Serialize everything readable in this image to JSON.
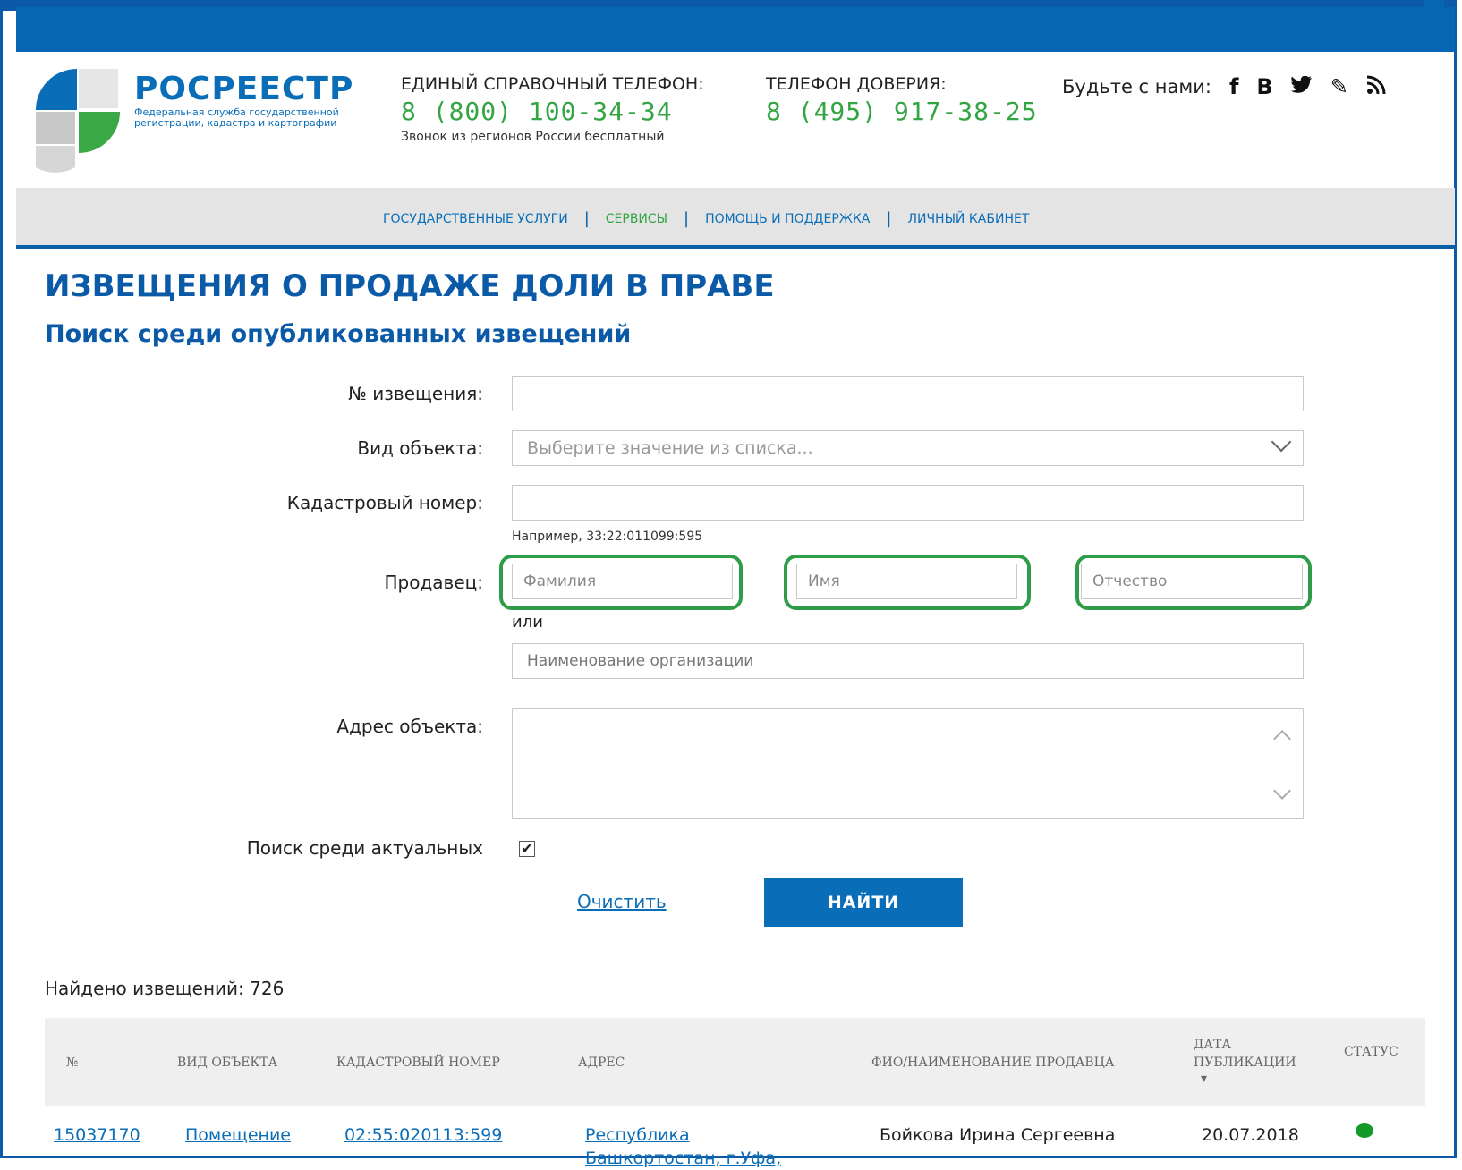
{
  "brand": {
    "name": "РОСРЕЕСТР",
    "subtitle": "Федеральная служба государственной регистрации, кадастра и картографии"
  },
  "phones": {
    "main_title": "ЕДИНЫЙ СПРАВОЧНЫЙ ТЕЛЕФОН:",
    "main_number": "8 (800) 100-34-34",
    "main_note": "Звонок из регионов России бесплатный",
    "trust_title": "ТЕЛЕФОН ДОВЕРИЯ:",
    "trust_number": "8 (495) 917-38-25"
  },
  "social": {
    "label": "Будьте с нами:",
    "icons": [
      "facebook-icon",
      "vk-icon",
      "twitter-icon",
      "livejournal-icon",
      "rss-icon"
    ],
    "glyphs": [
      "f",
      "В",
      "🐦",
      "✎",
      "⟩"
    ]
  },
  "nav": {
    "items": [
      "ГОСУДАРСТВЕННЫЕ УСЛУГИ",
      "СЕРВИСЫ",
      "ПОМОЩЬ И ПОДДЕРЖКА",
      "ЛИЧНЫЙ КАБИНЕТ"
    ],
    "separator": "|"
  },
  "page": {
    "title": "ИЗВЕЩЕНИЯ О ПРОДАЖЕ ДОЛИ В ПРАВЕ",
    "subtitle": "Поиск среди опубликованных извещений"
  },
  "form": {
    "notice_label": "№ извещения:",
    "notice_value": "",
    "object_type_label": "Вид объекта:",
    "object_type_placeholder": "Выберите значение из списка...",
    "cadastral_label": "Кадастровый номер:",
    "cadastral_value": "",
    "cadastral_hint": "Например, 33:22:011099:595",
    "seller_label": "Продавец:",
    "last_name_placeholder": "Фамилия",
    "first_name_placeholder": "Имя",
    "patronymic_placeholder": "Отчество",
    "or_text": "или",
    "org_placeholder": "Наименование организации",
    "address_label": "Адрес объекта:",
    "actual_label": "Поиск среди актуальных",
    "actual_checked": "✔",
    "clear_label": "Очистить",
    "find_label": "НАЙТИ"
  },
  "results": {
    "found_text": "Найдено извещений: 726",
    "columns": [
      "№",
      "ВИД ОБЪЕКТА",
      "КАДАСТРОВЫЙ НОМЕР",
      "АДРЕС",
      "ФИО/НАИМЕНОВАНИЕ ПРОДАВЦА",
      "ДАТА ПУБЛИКАЦИИ",
      "СТАТУС"
    ],
    "sort_indicator": "▾",
    "rows": [
      {
        "number": "15037170",
        "object_type": "Помещение",
        "cadastral": "02:55:020113:599",
        "address_line1": "Республика",
        "address_line2": "Башкортостан, г.Уфа,",
        "seller": "Бойкова Ирина Сергеевна",
        "date": "20.07.2018",
        "status_color": "#139a2a"
      }
    ]
  },
  "colors": {
    "brand_blue": "#0666b3",
    "accent_green": "#33a542",
    "highlight_ring": "#2f9d48"
  }
}
